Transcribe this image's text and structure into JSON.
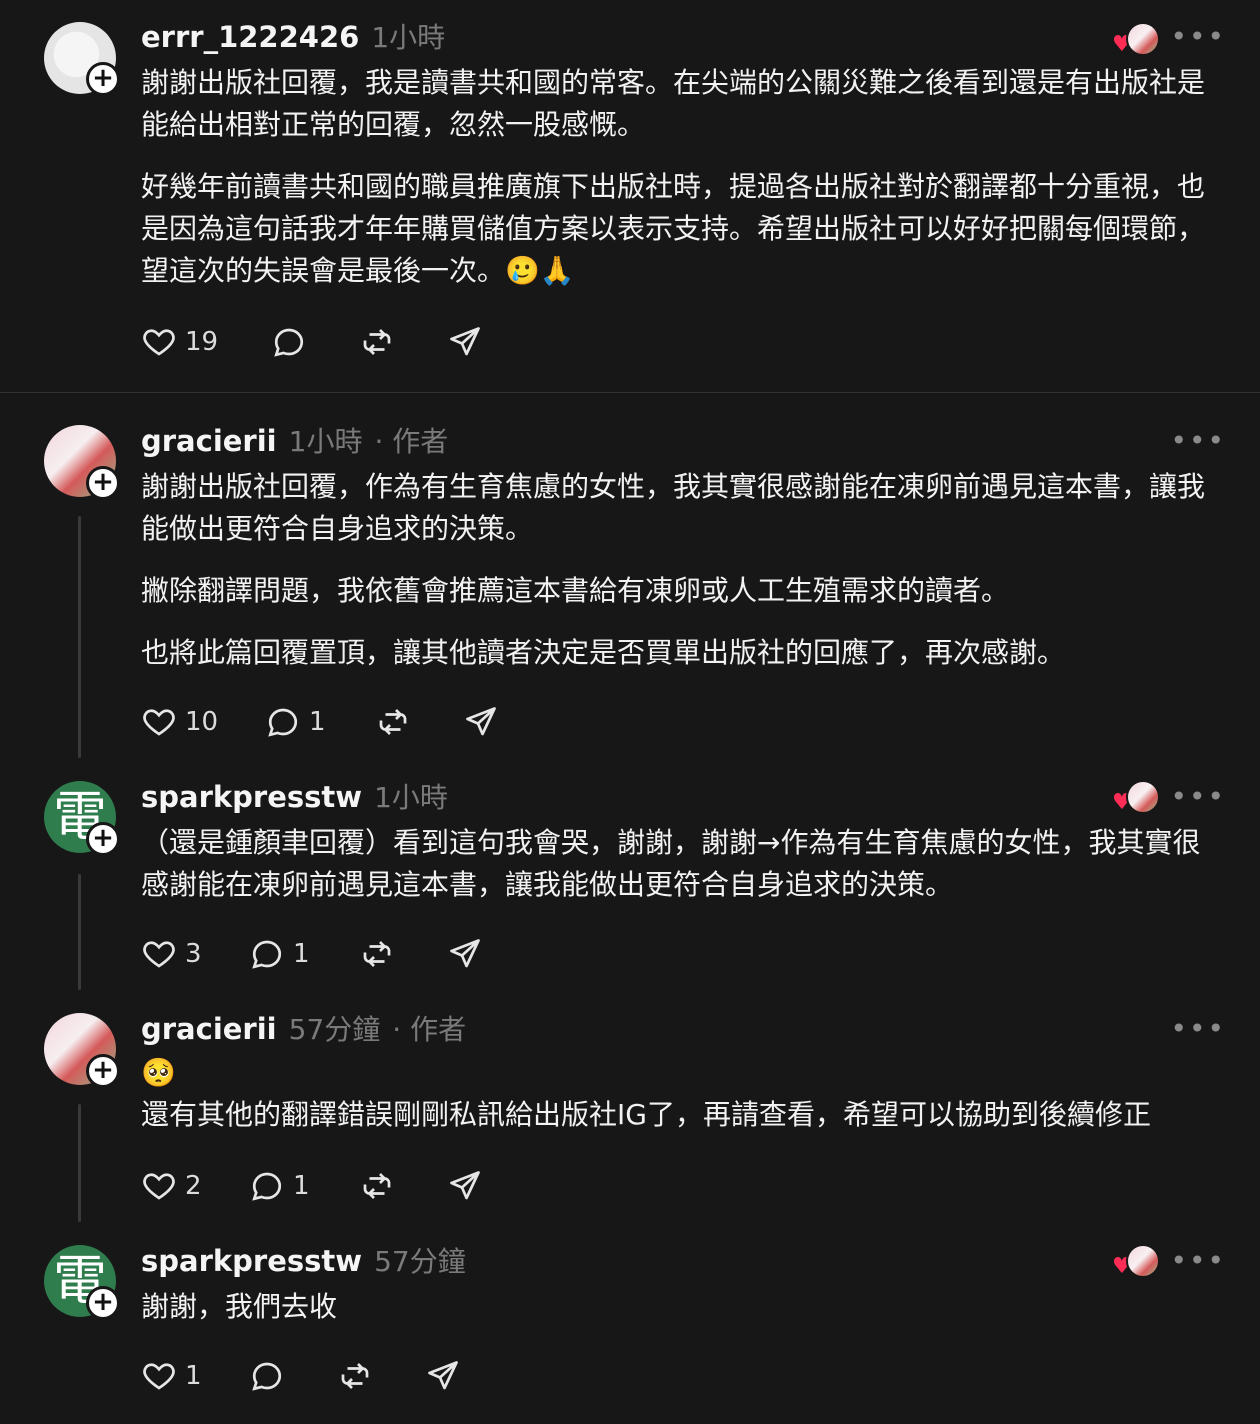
{
  "posts": [
    {
      "username": "errr_1222426",
      "time": "1小時",
      "paragraphs": [
        "謝謝出版社回覆，我是讀書共和國的常客。在尖端的公關災難之後看到還是有出版社是能給出相對正常的回覆，忽然一股感慨。",
        "好幾年前讀書共和國的職員推廣旗下出版社時，提過各出版社對於翻譯都十分重視，也是因為這句話我才年年購買儲值方案以表示支持。希望出版社可以好好把關每個環節，望這次的失誤會是最後一次。🥲🙏"
      ],
      "likes": "19",
      "replies": ""
    },
    {
      "username": "gracierii",
      "time": "1小時",
      "tag": "· 作者",
      "paragraphs": [
        "謝謝出版社回覆，作為有生育焦慮的女性，我其實很感謝能在凍卵前遇見這本書，讓我能做出更符合自身追求的決策。",
        "撇除翻譯問題，我依舊會推薦這本書給有凍卵或人工生殖需求的讀者。",
        "也將此篇回覆置頂，讓其他讀者決定是否買單出版社的回應了，再次感謝。"
      ],
      "likes": "10",
      "replies": "1"
    },
    {
      "username": "sparkpresstw",
      "time": "1小時",
      "avatar_char": "電",
      "paragraphs": [
        "（還是鍾顏聿回覆）看到這句我會哭，謝謝，謝謝→作為有生育焦慮的女性，我其實很感謝能在凍卵前遇見這本書，讓我能做出更符合自身追求的決策。"
      ],
      "likes": "3",
      "replies": "1"
    },
    {
      "username": "gracierii",
      "time": "57分鐘",
      "tag": "· 作者",
      "paragraphs": [
        "🥺",
        "還有其他的翻譯錯誤剛剛私訊給出版社IG了，再請查看，希望可以協助到後續修正"
      ],
      "likes": "2",
      "replies": "1"
    },
    {
      "username": "sparkpresstw",
      "time": "57分鐘",
      "avatar_char": "電",
      "paragraphs": [
        "謝謝，我們去收"
      ],
      "likes": "1",
      "replies": ""
    }
  ],
  "ui": {
    "more": "•••",
    "follow": "+",
    "heart": "♥"
  }
}
